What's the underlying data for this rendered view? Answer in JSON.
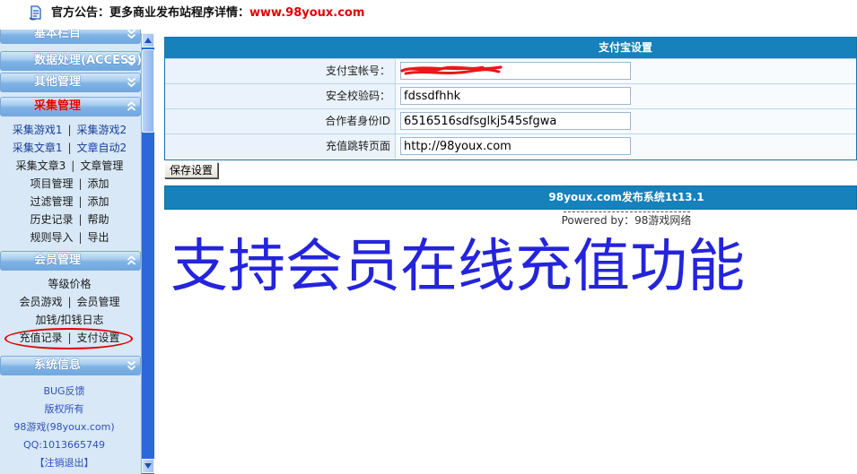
{
  "announcement": {
    "icon": "announcement-icon",
    "label": "官方公告：更多商业发布站程序详情：",
    "link": "www.98youx.com"
  },
  "sidebar": {
    "separator": "|",
    "sections": [
      {
        "title": "基本栏目",
        "icon": "chevron-double-down-icon"
      },
      {
        "title": "数据处理(ACCESS)",
        "icon": "chevron-double-down-icon"
      },
      {
        "title": "其他管理",
        "icon": "chevron-double-down-icon"
      },
      {
        "title": "采集管理",
        "icon": "chevron-double-up-icon",
        "rows": [
          [
            "采集游戏1",
            "采集游戏2"
          ],
          [
            "采集文章1",
            "文章自动2"
          ],
          [
            "采集文章3",
            "文章管理"
          ],
          [
            "项目管理",
            "添加"
          ],
          [
            "过滤管理",
            "添加"
          ],
          [
            "历史记录",
            "帮助"
          ],
          [
            "规则导入",
            "导出"
          ]
        ]
      },
      {
        "title": "会员管理",
        "icon": "chevron-double-up-icon",
        "rows": [
          [
            "等级价格"
          ],
          [
            "会员游戏",
            "会员管理"
          ],
          [
            "加钱/扣钱日志"
          ],
          [
            "充值记录",
            "支付设置"
          ]
        ]
      },
      {
        "title": "系统信息",
        "icon": "chevron-double-down-icon",
        "rows": [
          [
            "BUG反馈"
          ],
          [
            "版权所有"
          ],
          [
            "98游戏(98youx.com)"
          ],
          [
            "QQ:1013665749"
          ],
          [
            "【注销退出】"
          ]
        ]
      }
    ]
  },
  "alipay_settings": {
    "title": "支付宝设置",
    "fields": [
      {
        "label": "支付宝帐号：",
        "value": ""
      },
      {
        "label": "安全校验码：",
        "value": "fdssdfhhk"
      },
      {
        "label": "合作者身份ID",
        "value": "6516516sdfsglkj545sfgwa"
      },
      {
        "label": "充值跳转页面",
        "value": "http://98youx.com"
      }
    ],
    "save_button": "保存设置"
  },
  "footer": {
    "system_name": "98youx.com发布系统1t13.1",
    "powered_by": "Powered by：98游戏网络"
  },
  "promo_text": "支持会员在线充值功能",
  "colors": {
    "announcement_link": "#e00000",
    "active_section": "#e00000",
    "table_header": "#1681ba",
    "promo_text": "#2424dc",
    "highlight_ellipse": "#e00000",
    "redaction": "#e8181c"
  }
}
